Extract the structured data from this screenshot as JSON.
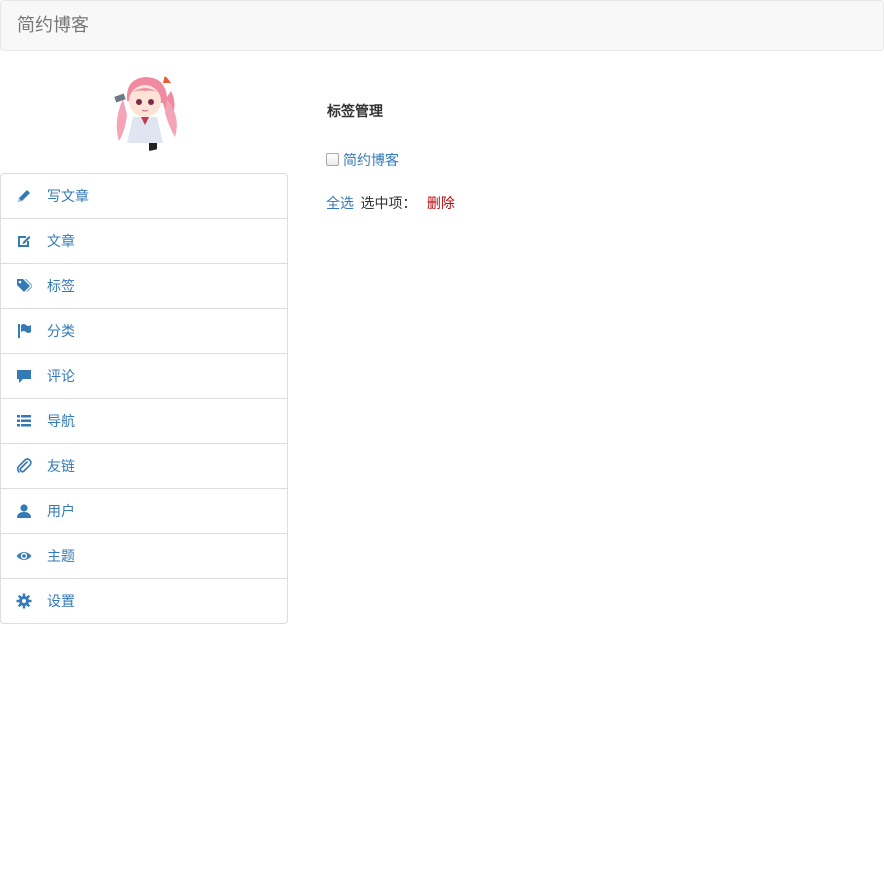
{
  "navbar": {
    "brand": "简约博客"
  },
  "sidebar": {
    "items": [
      {
        "label": "写文章",
        "icon": "pencil-icon"
      },
      {
        "label": "文章",
        "icon": "edit-icon"
      },
      {
        "label": "标签",
        "icon": "tags-icon"
      },
      {
        "label": "分类",
        "icon": "flag-icon"
      },
      {
        "label": "评论",
        "icon": "comment-icon"
      },
      {
        "label": "导航",
        "icon": "list-icon"
      },
      {
        "label": "友链",
        "icon": "paperclip-icon"
      },
      {
        "label": "用户",
        "icon": "user-icon"
      },
      {
        "label": "主题",
        "icon": "eye-icon"
      },
      {
        "label": "设置",
        "icon": "gear-icon"
      }
    ]
  },
  "main": {
    "title": "标签管理",
    "tags": [
      {
        "name": "简约博客",
        "checked": false
      }
    ],
    "actions": {
      "select_all": "全选",
      "selected_label": "选中项：",
      "delete": "删除"
    }
  },
  "colors": {
    "link": "#337ab7",
    "danger": "#b50a0a",
    "navbar_bg": "#f8f8f8",
    "border": "#dddddd"
  }
}
